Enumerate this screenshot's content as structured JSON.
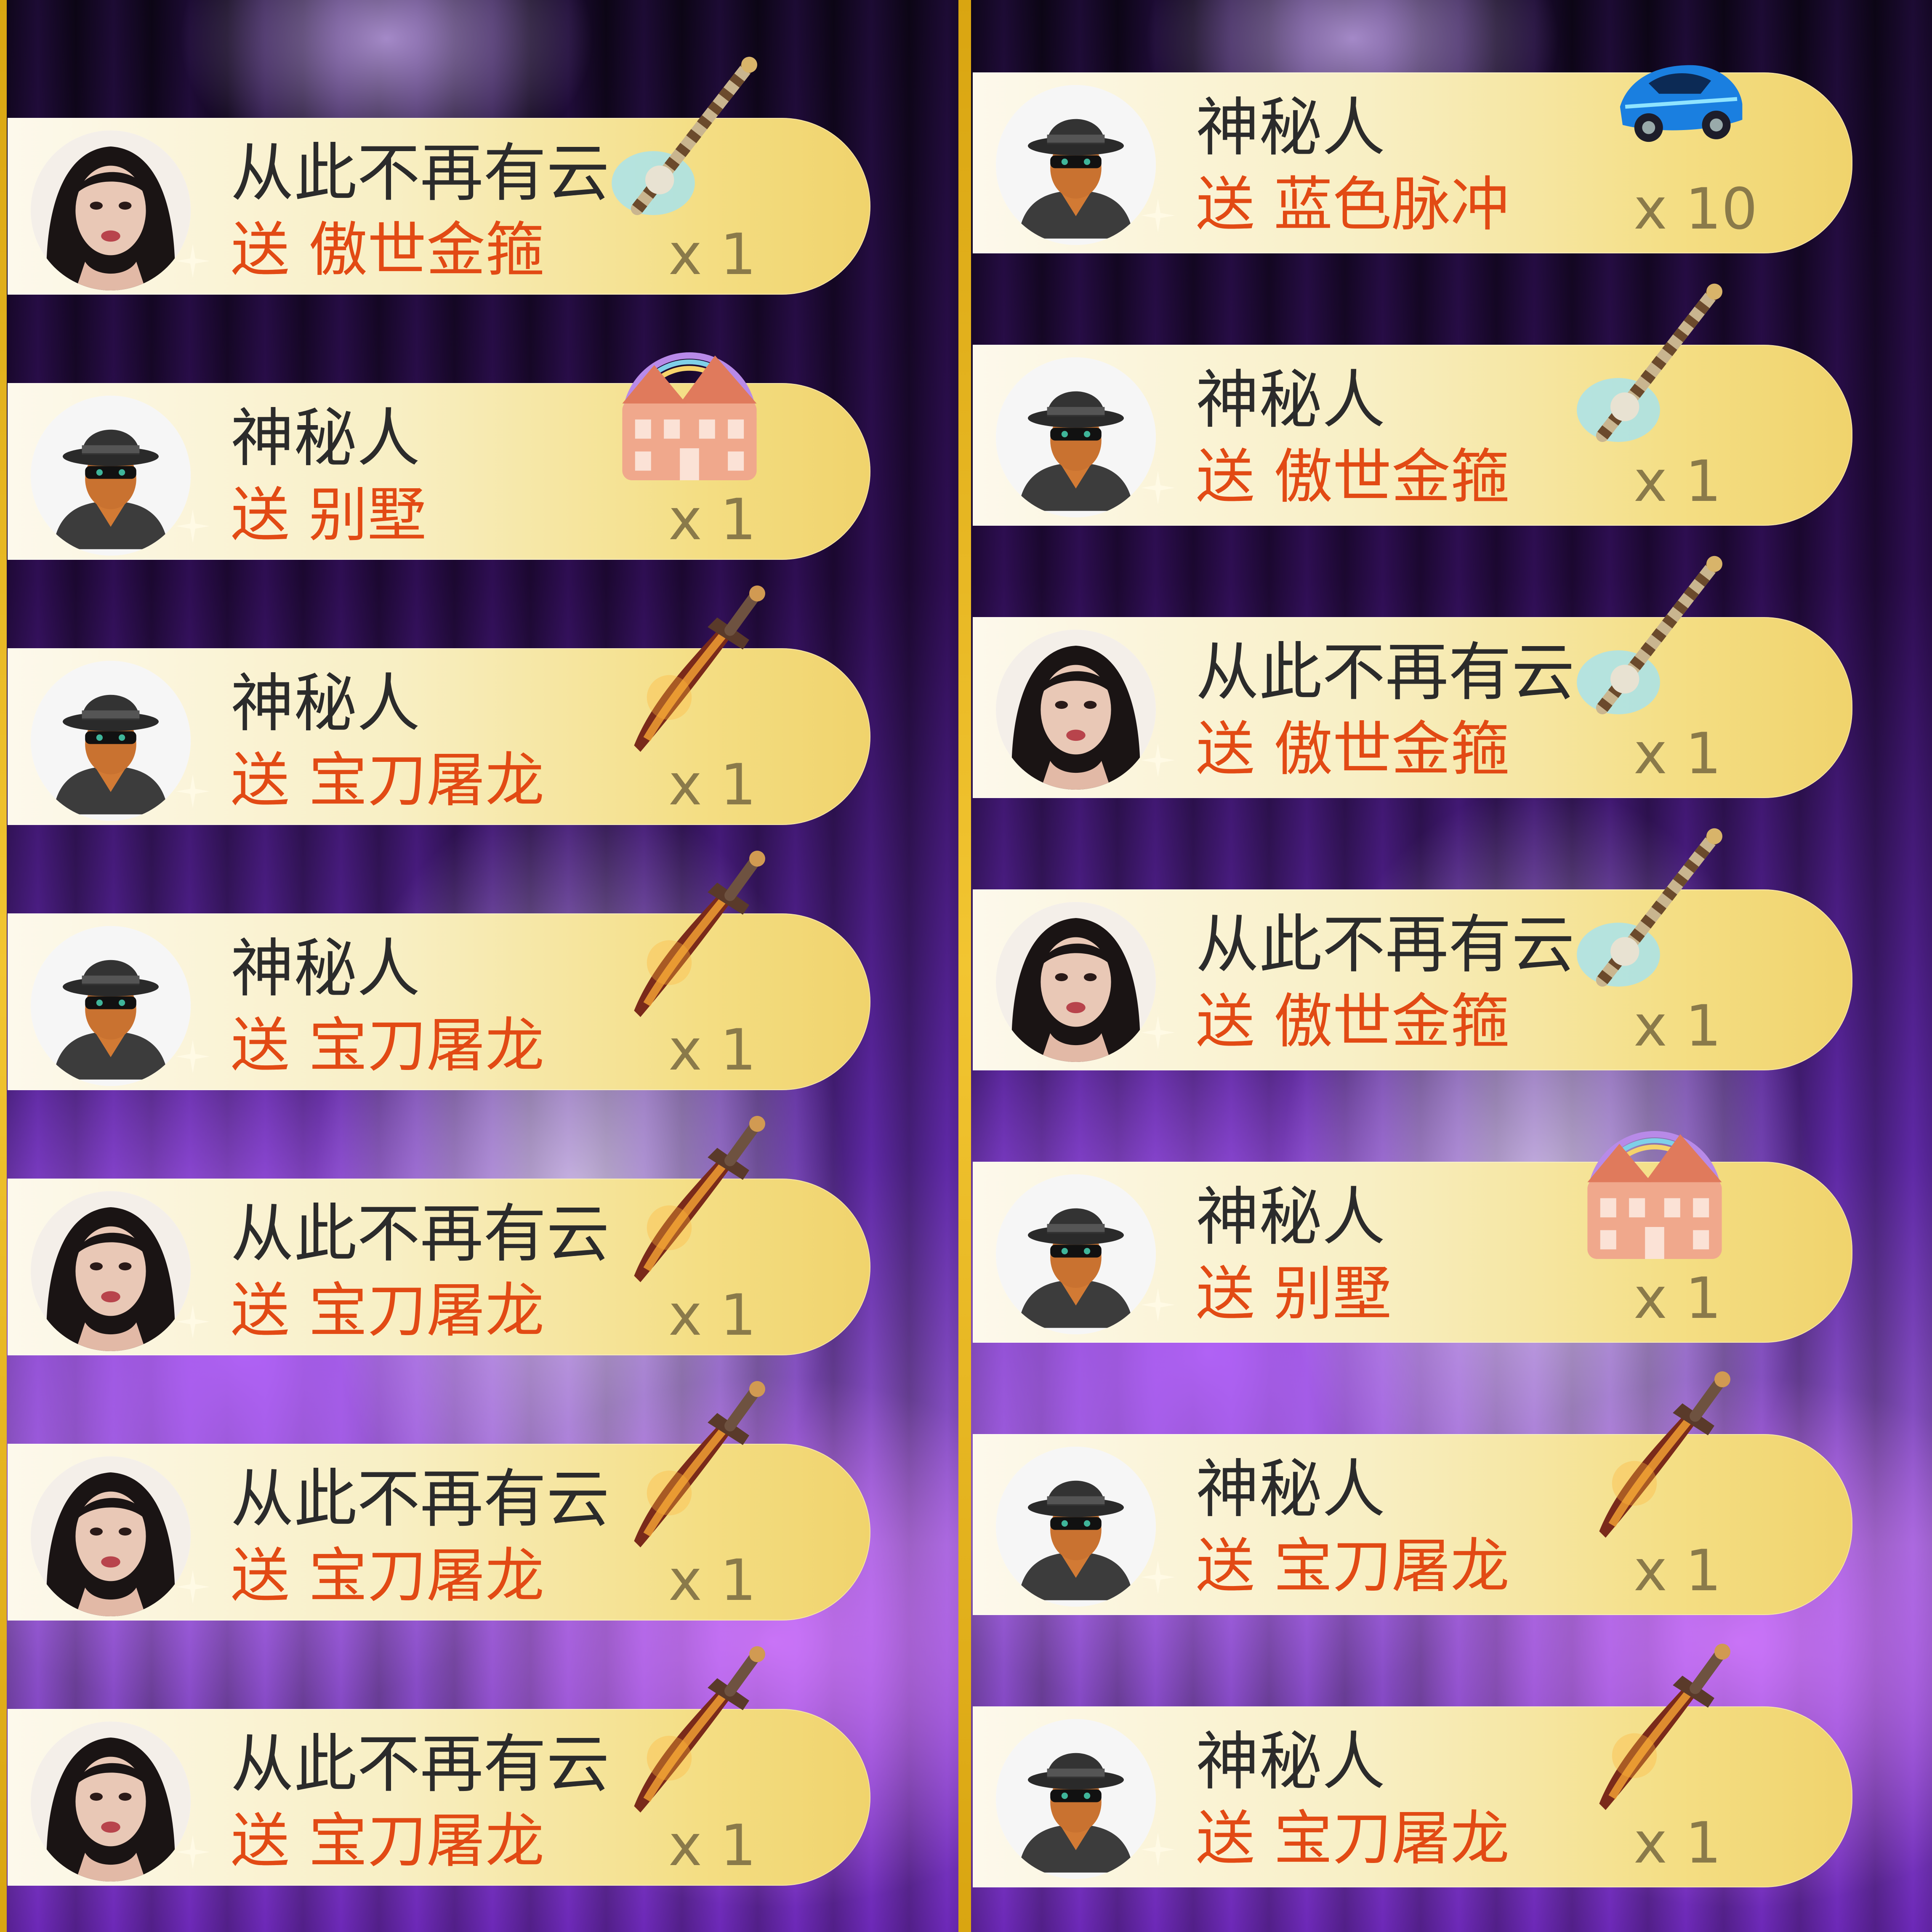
{
  "send_word": "送",
  "icons": {
    "avatar_girl": "girl-avatar-icon",
    "avatar_mystery": "mystery-man-avatar-icon",
    "傲世金箍": "golden-staff-gift-icon",
    "别墅": "villa-gift-icon",
    "宝刀屠龙": "dragon-saber-gift-icon",
    "蓝色脉冲": "blue-sports-car-gift-icon"
  },
  "colors": {
    "card_light": "#fdf9ec",
    "card_gold": "#f0d36c",
    "sender_text": "#2b2b2b",
    "gift_text": "#e24a14",
    "count_text": "#8a7a4a",
    "frame_gold": "#e2b420"
  },
  "columns": {
    "left": [
      {
        "avatar": "girl",
        "sender": "从此不再有云",
        "gift": "傲世金箍",
        "count": "x 1"
      },
      {
        "avatar": "mystery",
        "sender": "神秘人",
        "gift": "别墅",
        "count": "x 1"
      },
      {
        "avatar": "mystery",
        "sender": "神秘人",
        "gift": "宝刀屠龙",
        "count": "x 1"
      },
      {
        "avatar": "mystery",
        "sender": "神秘人",
        "gift": "宝刀屠龙",
        "count": "x 1"
      },
      {
        "avatar": "girl",
        "sender": "从此不再有云",
        "gift": "宝刀屠龙",
        "count": "x 1"
      },
      {
        "avatar": "girl",
        "sender": "从此不再有云",
        "gift": "宝刀屠龙",
        "count": "x 1"
      },
      {
        "avatar": "girl",
        "sender": "从此不再有云",
        "gift": "宝刀屠龙",
        "count": "x 1"
      }
    ],
    "right": [
      {
        "avatar": "mystery",
        "sender": "神秘人",
        "gift": "蓝色脉冲",
        "count": "x 10"
      },
      {
        "avatar": "mystery",
        "sender": "神秘人",
        "gift": "傲世金箍",
        "count": "x 1"
      },
      {
        "avatar": "girl",
        "sender": "从此不再有云",
        "gift": "傲世金箍",
        "count": "x 1"
      },
      {
        "avatar": "girl",
        "sender": "从此不再有云",
        "gift": "傲世金箍",
        "count": "x 1"
      },
      {
        "avatar": "mystery",
        "sender": "神秘人",
        "gift": "别墅",
        "count": "x 1"
      },
      {
        "avatar": "mystery",
        "sender": "神秘人",
        "gift": "宝刀屠龙",
        "count": "x 1"
      },
      {
        "avatar": "mystery",
        "sender": "神秘人",
        "gift": "宝刀屠龙",
        "count": "x 1"
      }
    ]
  }
}
